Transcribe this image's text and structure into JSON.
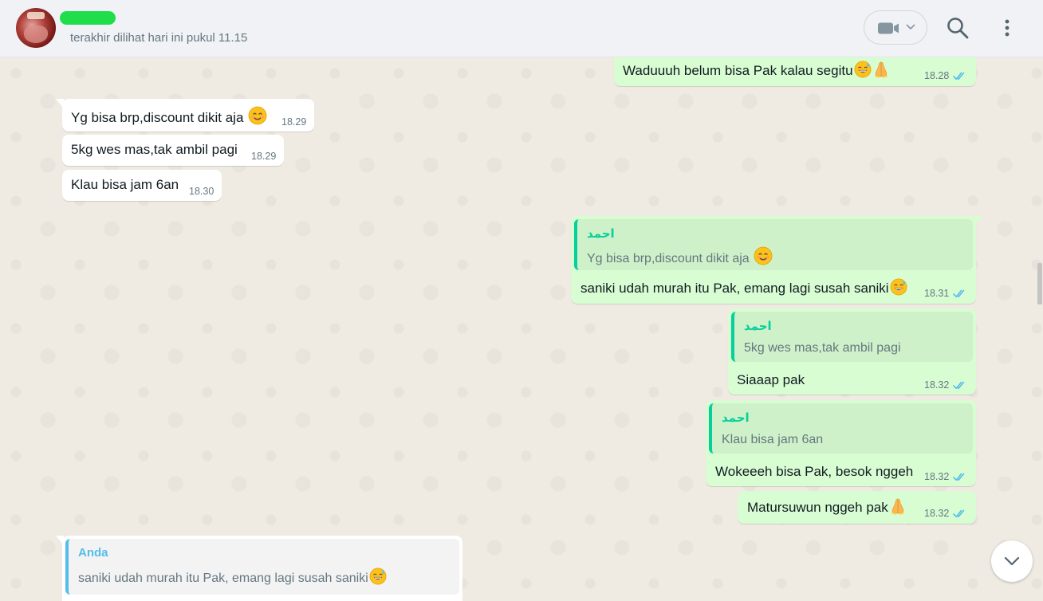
{
  "header": {
    "last_seen": "terakhir dilihat hari ini pukul 11.15",
    "icons": [
      "video-call-icon",
      "chevron-down-icon",
      "search-icon",
      "menu-icon"
    ]
  },
  "colors": {
    "incoming_bubble": "#ffffff",
    "outgoing_bubble": "#d9fdd3",
    "read_ticks": "#53bdeb",
    "quote_author": "#06cf9c",
    "self_quote_author": "#53bdeb"
  },
  "messages": [
    {
      "direction": "out",
      "text": "Waduuuh belum bisa Pak kalau segitu",
      "emoji": [
        "grinning-sweat-emoji",
        "folded-hands-emoji"
      ],
      "time": "18.28",
      "status": "read"
    },
    {
      "direction": "in",
      "text": "Yg bisa brp,discount dikit aja",
      "emoji": [
        "smiling-emoji"
      ],
      "time": "18.29"
    },
    {
      "direction": "in",
      "text": "5kg wes mas,tak ambil pagi",
      "time": "18.29"
    },
    {
      "direction": "in",
      "text": "Klau bisa jam 6an",
      "time": "18.30"
    },
    {
      "direction": "out",
      "quote_author": "احمد",
      "quote_text": "Yg bisa brp,discount dikit aja",
      "text": "saniki udah murah itu Pak, emang lagi susah saniki",
      "time": "18.31",
      "status": "read"
    },
    {
      "direction": "out",
      "quote_author": "احمد",
      "quote_text": "5kg wes mas,tak ambil pagi",
      "text": "Siaaap pak",
      "time": "18.32",
      "status": "read"
    },
    {
      "direction": "out",
      "quote_author": "احمد",
      "quote_text": "Klau bisa jam 6an",
      "text": "Wokeeeh bisa Pak, besok nggeh",
      "time": "18.32",
      "status": "read"
    },
    {
      "direction": "out",
      "text": "Matursuwun nggeh pak",
      "emoji": [
        "folded-hands-emoji"
      ],
      "time": "18.32",
      "status": "read"
    },
    {
      "direction": "in",
      "quote_author": "Anda",
      "quote_text": "saniki udah murah itu Pak, emang lagi susah saniki"
    }
  ]
}
